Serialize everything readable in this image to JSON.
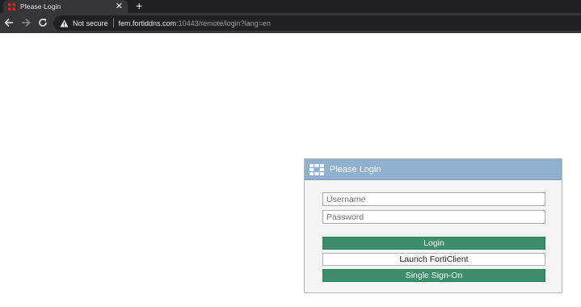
{
  "browser": {
    "tab": {
      "title": "Please Login",
      "close_label": "✕",
      "favicon": "fortinet-icon"
    },
    "new_tab_label": "+",
    "nav": {
      "back_icon": "arrow-left-icon",
      "forward_icon": "arrow-right-icon",
      "reload_icon": "reload-icon"
    },
    "address_bar": {
      "security_label": "Not secure",
      "url_host": "fem.fortiddns.com",
      "url_rest": ":10443/remote/login?lang=en"
    }
  },
  "login": {
    "title": "Please Login",
    "username_placeholder": "Username",
    "password_placeholder": "Password",
    "login_button": "Login",
    "forticlient_button": "Launch FortiClient",
    "sso_button": "Single Sign-On",
    "colors": {
      "header": "#8fb0cf",
      "primary_button": "#3b8d6c"
    }
  }
}
